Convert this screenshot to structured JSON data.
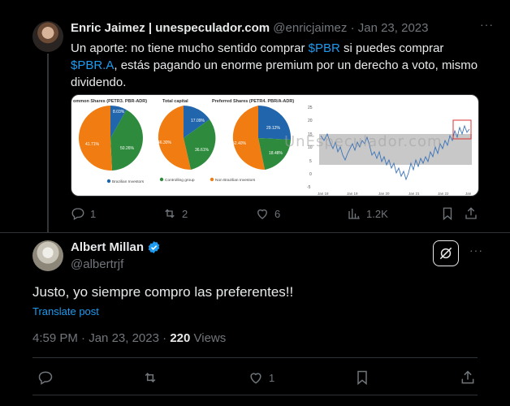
{
  "parent_tweet": {
    "author_name": "Enric Jaimez | unespeculador.com",
    "author_handle": "@enricjaimez",
    "separator": "·",
    "date": "Jan 23, 2023",
    "more": "···",
    "text_part1": "Un aporte: no tiene mucho sentido comprar ",
    "cashtag1": "$PBR",
    "text_part2": " si puedes comprar ",
    "cashtag2": "$PBR.A",
    "text_part3": ", estás pagando un enorme premium por un derecho a voto, mismo dividendo.",
    "media": {
      "watermark": "UnEspeculador.com",
      "pies": [
        {
          "title": "ommon Shares (PETR3. PBR-ADR)",
          "labels": [
            "8.03%",
            "50.26%",
            "41.71%"
          ]
        },
        {
          "title": "Total capital",
          "labels": [
            "17.09%",
            "36.61%",
            "46.30%"
          ]
        },
        {
          "title": "Preferred Shares (PETR4. PBR/A-ADR)",
          "labels": [
            "29.12%",
            "18.48%",
            "52.40%"
          ]
        }
      ],
      "legend": [
        "Brazilian Investors",
        "Controlling group",
        "Non Brazilian Investors"
      ],
      "line_y_ticks": [
        "25",
        "20",
        "15",
        "10",
        "5",
        "0",
        "-5"
      ],
      "line_x_ticks": [
        "Jan 18",
        "Jan 19",
        "Jan 20",
        "Jan 21",
        "Jan 22",
        "Jan"
      ]
    },
    "actions": {
      "replies": "1",
      "reposts": "2",
      "likes": "6",
      "views": "1.2K"
    }
  },
  "main_tweet": {
    "author_name": "Albert Millan",
    "author_handle": "@albertrjf",
    "more": "···",
    "text": "Justo, yo siempre compro las preferentes!!",
    "translate": "Translate post",
    "time": "4:59 PM",
    "separator": "·",
    "date": "Jan 23, 2023",
    "dot": "·",
    "views_count": "220",
    "views_label": "Views",
    "actions": {
      "likes": "1"
    }
  },
  "colors": {
    "blue": "#1d9bf0",
    "green": "#2e8b3e",
    "orange": "#f07c12",
    "pie_blue": "#2166ac"
  }
}
